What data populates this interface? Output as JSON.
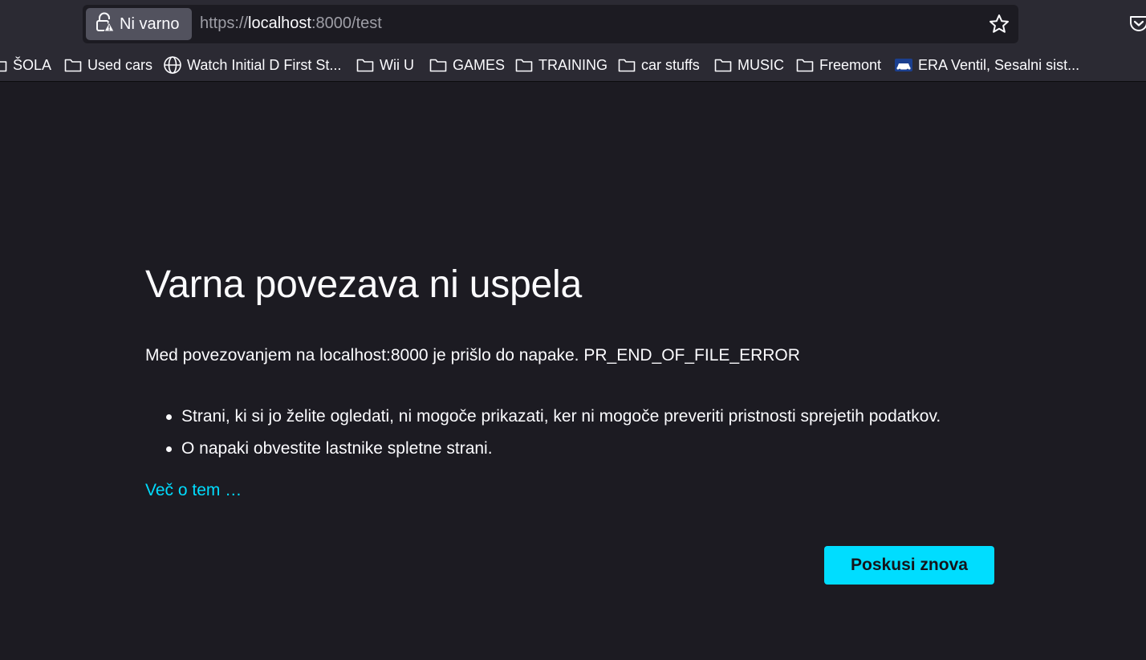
{
  "browser": {
    "site_identity_label": "Ni varno",
    "url": {
      "scheme": "https://",
      "host": "localhost",
      "rest": ":8000/test"
    }
  },
  "bookmarks": [
    {
      "label": "ŠOLA",
      "icon": "folder-icon"
    },
    {
      "label": "Used cars",
      "icon": "folder-icon"
    },
    {
      "label": "Watch Initial D First St...",
      "icon": "globe-icon"
    },
    {
      "label": "Wii U",
      "icon": "folder-icon"
    },
    {
      "label": "GAMES",
      "icon": "folder-icon"
    },
    {
      "label": "TRAINING",
      "icon": "folder-icon"
    },
    {
      "label": "car stuffs",
      "icon": "folder-icon"
    },
    {
      "label": "MUSIC",
      "icon": "folder-icon"
    },
    {
      "label": "Freemont",
      "icon": "folder-icon"
    },
    {
      "label": "ERA Ventil, Sesalni sist...",
      "icon": "car-favicon-icon"
    }
  ],
  "error_page": {
    "title": "Varna povezava ni uspela",
    "description": "Med povezovanjem na localhost:8000 je prišlo do napake. PR_END_OF_FILE_ERROR",
    "bullets": [
      "Strani, ki si jo želite ogledati, ni mogoče prikazati, ker ni mogoče preveriti pristnosti sprejetih podatkov.",
      "O napaki obvestite lastnike spletne strani."
    ],
    "learn_more": "Več o tem …",
    "retry_button": "Poskusi znova"
  },
  "colors": {
    "background": "#1c1b22",
    "toolbar": "#2b2a33",
    "accent": "#00ddff",
    "text": "#fbfbfe"
  }
}
